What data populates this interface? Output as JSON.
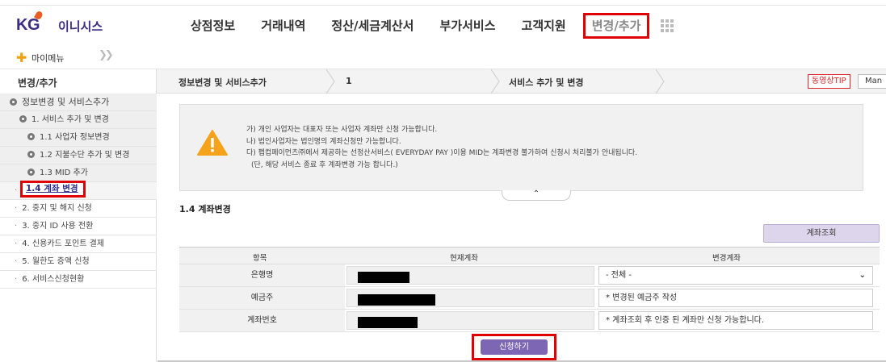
{
  "header": {
    "logo_kg": "KG",
    "logo_brand": "이니시스",
    "nav": [
      "상점정보",
      "거래내역",
      "정산/세금계산서",
      "부가서비스",
      "고객지원"
    ],
    "nav_active": "변경/추가",
    "apps_icon": "grid-icon"
  },
  "mymenu": {
    "label": "마이메뉴",
    "plus_icon": "plus-icon",
    "toggle_icon": "double-chevron-icon"
  },
  "breadcrumb": {
    "section_title": "변경/추가",
    "step1": "정보변경 및 서비스추가",
    "step2": "1",
    "step3": "서비스 추가 및 변경",
    "tip_button": "동영상TIP",
    "manual_button": "Man"
  },
  "sidebar": {
    "group": "정보변경 및 서비스추가",
    "items": [
      {
        "label": "1. 서비스 추가 및 변경"
      },
      {
        "label": "1.1 사업자 정보변경"
      },
      {
        "label": "1.2 지불수단 추가 및 변경"
      },
      {
        "label": "1.3 MID 추가"
      },
      {
        "label": "1.4 계좌 변경"
      },
      {
        "label": "2. 중지 및 해지 신청"
      },
      {
        "label": "3. 중지 ID 사용 전환"
      },
      {
        "label": "4. 신용카드 포인트 결제"
      },
      {
        "label": "5. 월한도 증액 신청"
      },
      {
        "label": "6. 서비스신청현황"
      }
    ]
  },
  "notice": {
    "lines": [
      "가) 개인 사업자는 대표자 또는 사업자 계좌만 신청 가능합니다.",
      "나) 법인사업자는 법인명의 계좌신청만 가능합니다.",
      "다) 펩컵페이먼츠㈜에서 제공하는 선정산서비스( EVERYDAY PAY )이용 MID는 계좌변경 불가하여 신청시 처리불가 안내됩니다.",
      "(단, 해당 서비스 종료 후 계좌변경 가능 합니다.)"
    ],
    "collapse_symbol": "⌃"
  },
  "section": {
    "title": "1.4 계좌변경",
    "lookup_button": "계좌조회"
  },
  "table": {
    "headers": [
      "항목",
      "현재계좌",
      "변경계좌"
    ],
    "rows": [
      {
        "label": "은행명",
        "new_value": "- 전체 -",
        "has_select": true
      },
      {
        "label": "예금주",
        "new_value": "* 변경된 예금주 작성",
        "has_select": false
      },
      {
        "label": "계좌번호",
        "new_value": "* 계좌조회 후 인증 된 계좌만 신청 가능합니다.",
        "has_select": false
      }
    ]
  },
  "submit_button": "신청하기"
}
